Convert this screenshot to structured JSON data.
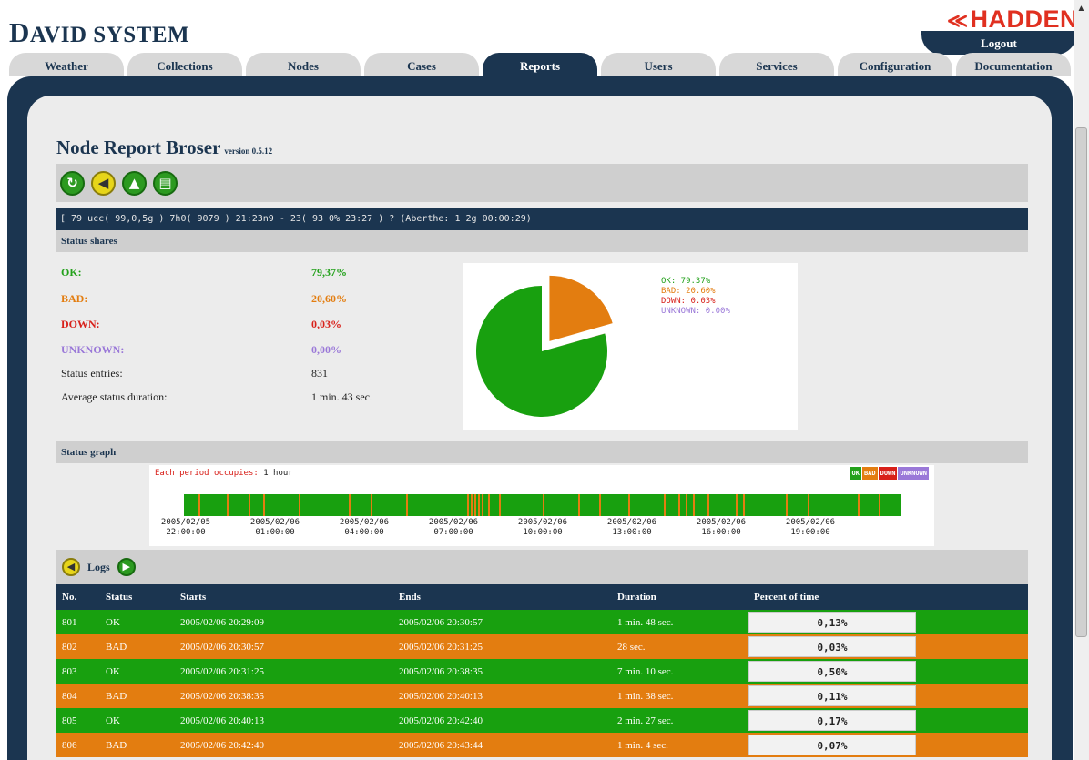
{
  "header": {
    "title_first": "D",
    "title_rest": "AVID SYSTEM",
    "brand": "HADDEN",
    "logout": "Logout"
  },
  "tabs": [
    {
      "label": "Weather",
      "active": false
    },
    {
      "label": "Collections",
      "active": false
    },
    {
      "label": "Nodes",
      "active": false
    },
    {
      "label": "Cases",
      "active": false
    },
    {
      "label": "Reports",
      "active": true
    },
    {
      "label": "Users",
      "active": false
    },
    {
      "label": "Services",
      "active": false
    },
    {
      "label": "Configuration",
      "active": false
    },
    {
      "label": "Documentation",
      "active": false
    }
  ],
  "page": {
    "title": "Node Report Broser",
    "version": "version 0.5.12",
    "toolbar_icons": [
      "refresh-icon",
      "back-icon",
      "up-icon",
      "print-icon"
    ],
    "info_bar": "[ 79 ucc( 99,0,5g ) 7h0( 9079 ) 21:23n9 - 23( 93 0% 23:27 ) ? (Aberthe: 1 2g 00:00:29)"
  },
  "status_shares": {
    "header": "Status shares",
    "rows": {
      "ok": {
        "label": "OK:",
        "value": "79,37%"
      },
      "bad": {
        "label": "BAD:",
        "value": "20,60%"
      },
      "down": {
        "label": "DOWN:",
        "value": "0,03%"
      },
      "unknown": {
        "label": "UNKNOWN:",
        "value": "0,00%"
      },
      "entries": {
        "label": "Status entries:",
        "value": "831"
      },
      "avg": {
        "label": "Average status duration:",
        "value": "1 min. 43 sec."
      }
    },
    "pie_legend": {
      "ok": "OK: 79.37%",
      "bad": "BAD: 20.60%",
      "down": "DOWN: 0.03%",
      "unknown": "UNKNOWN: 0.00%"
    },
    "pie_slices": {
      "ok": 79.37,
      "bad": 20.6,
      "down": 0.03,
      "unknown": 0.0
    }
  },
  "status_graph": {
    "header": "Status graph",
    "period_label": "Each period occupies:",
    "period_value": "1 hour",
    "legend": [
      "OK",
      "BAD",
      "DOWN",
      "UNKNOWN"
    ],
    "ticks": [
      [
        "2005/02/05",
        "22:00:00"
      ],
      [
        "2005/02/06",
        "01:00:00"
      ],
      [
        "2005/02/06",
        "04:00:00"
      ],
      [
        "2005/02/06",
        "07:00:00"
      ],
      [
        "2005/02/06",
        "10:00:00"
      ],
      [
        "2005/02/06",
        "13:00:00"
      ],
      [
        "2005/02/06",
        "16:00:00"
      ],
      [
        "2005/02/06",
        "19:00:00"
      ]
    ],
    "bad_marks": [
      0.02,
      0.06,
      0.09,
      0.11,
      0.16,
      0.23,
      0.26,
      0.31,
      0.395,
      0.4,
      0.405,
      0.41,
      0.415,
      0.425,
      0.44,
      0.5,
      0.55,
      0.58,
      0.62,
      0.67,
      0.69,
      0.7,
      0.71,
      0.73,
      0.77,
      0.78,
      0.84,
      0.87,
      0.94,
      0.97
    ],
    "colors": {
      "ok": "#18a00f",
      "bad": "#e37d10",
      "down": "#d8201a",
      "unknown": "#9a78d8"
    }
  },
  "logs": {
    "title": "Logs",
    "columns": [
      "No.",
      "Status",
      "Starts",
      "Ends",
      "Duration",
      "Percent of time"
    ],
    "rows": [
      {
        "no": "801",
        "status": "OK",
        "starts": "2005/02/06 20:29:09",
        "ends": "2005/02/06 20:30:57",
        "duration": "1 min. 48 sec.",
        "percent": "0,13%"
      },
      {
        "no": "802",
        "status": "BAD",
        "starts": "2005/02/06 20:30:57",
        "ends": "2005/02/06 20:31:25",
        "duration": "28 sec.",
        "percent": "0,03%"
      },
      {
        "no": "803",
        "status": "OK",
        "starts": "2005/02/06 20:31:25",
        "ends": "2005/02/06 20:38:35",
        "duration": "7 min. 10 sec.",
        "percent": "0,50%"
      },
      {
        "no": "804",
        "status": "BAD",
        "starts": "2005/02/06 20:38:35",
        "ends": "2005/02/06 20:40:13",
        "duration": "1 min. 38 sec.",
        "percent": "0,11%"
      },
      {
        "no": "805",
        "status": "OK",
        "starts": "2005/02/06 20:40:13",
        "ends": "2005/02/06 20:42:40",
        "duration": "2 min. 27 sec.",
        "percent": "0,17%"
      },
      {
        "no": "806",
        "status": "BAD",
        "starts": "2005/02/06 20:42:40",
        "ends": "2005/02/06 20:43:44",
        "duration": "1 min. 4 sec.",
        "percent": "0,07%"
      }
    ]
  }
}
